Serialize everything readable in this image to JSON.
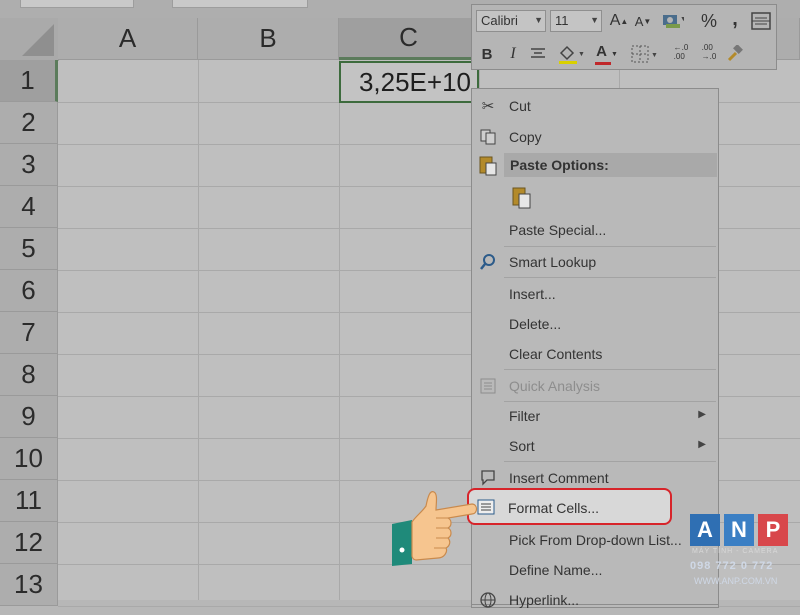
{
  "spreadsheet": {
    "columns": [
      "A",
      "B",
      "C"
    ],
    "rows": [
      "1",
      "2",
      "3",
      "4",
      "5",
      "6",
      "7",
      "8",
      "9",
      "10",
      "11",
      "12",
      "13"
    ],
    "active_cell_value": "3,25E+10"
  },
  "mini_toolbar": {
    "font_name": "Calibri",
    "font_size": "11",
    "percent_label": "%",
    "comma_label": ",",
    "bold_label": "B",
    "italic_label": "I",
    "font_color_label": "A",
    "increase_font_label": "A",
    "decrease_font_label": "A",
    "increase_decimal_label": "←.0\n.00",
    "decrease_decimal_label": ".00\n→.0"
  },
  "context_menu": {
    "items": [
      {
        "label": "Cut",
        "icon": "scissors-icon"
      },
      {
        "label": "Copy",
        "icon": "copy-icon"
      },
      {
        "label": "Paste Options:",
        "icon": "paste-icon"
      },
      {
        "label": "Paste Special...",
        "icon": ""
      },
      {
        "label": "Smart Lookup",
        "icon": "search-icon"
      },
      {
        "label": "Insert...",
        "icon": ""
      },
      {
        "label": "Delete...",
        "icon": ""
      },
      {
        "label": "Clear Contents",
        "icon": ""
      },
      {
        "label": "Quick Analysis",
        "icon": "quick-analysis-icon"
      },
      {
        "label": "Filter",
        "icon": ""
      },
      {
        "label": "Sort",
        "icon": ""
      },
      {
        "label": "Insert Comment",
        "icon": "comment-icon"
      },
      {
        "label": "Format Cells...",
        "icon": "format-cells-icon"
      },
      {
        "label": "Pick From Drop-down List...",
        "icon": ""
      },
      {
        "label": "Define Name...",
        "icon": ""
      },
      {
        "label": "Hyperlink...",
        "icon": "hyperlink-icon"
      }
    ]
  },
  "watermark": {
    "letters": [
      "A",
      "N",
      "P"
    ],
    "tagline": "MÁY TÍNH - CAMERA",
    "phone": "098 772 0 772",
    "website": "WWW.ANP.COM.VN",
    "colors": {
      "a": "#2f6fb3",
      "n": "#3b7fc4",
      "p": "#d8474b"
    }
  },
  "colors": {
    "highlight_border": "#d7242a",
    "active_cell_border": "#3d6b3d"
  }
}
